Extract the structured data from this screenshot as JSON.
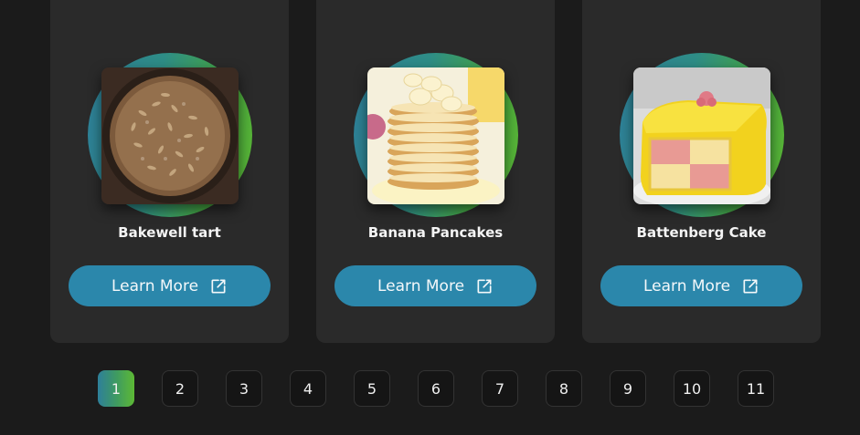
{
  "cards": [
    {
      "title": "Bakewell tart",
      "button_label": "Learn More",
      "image": "bakewell-tart-photo"
    },
    {
      "title": "Banana Pancakes",
      "button_label": "Learn More",
      "image": "banana-pancakes-photo"
    },
    {
      "title": "Battenberg Cake",
      "button_label": "Learn More",
      "image": "battenberg-cake-photo"
    }
  ],
  "icons": {
    "learn_more": "external-link-icon"
  },
  "pagination": {
    "pages": [
      "1",
      "2",
      "3",
      "4",
      "5",
      "6",
      "7",
      "8",
      "9",
      "10",
      "11"
    ],
    "current": "1"
  },
  "colors": {
    "background": "#1b1b1b",
    "card": "#2a2a2a",
    "button": "#2b87ab",
    "gradient_start": "#2e7f9a",
    "gradient_end": "#5db934"
  }
}
